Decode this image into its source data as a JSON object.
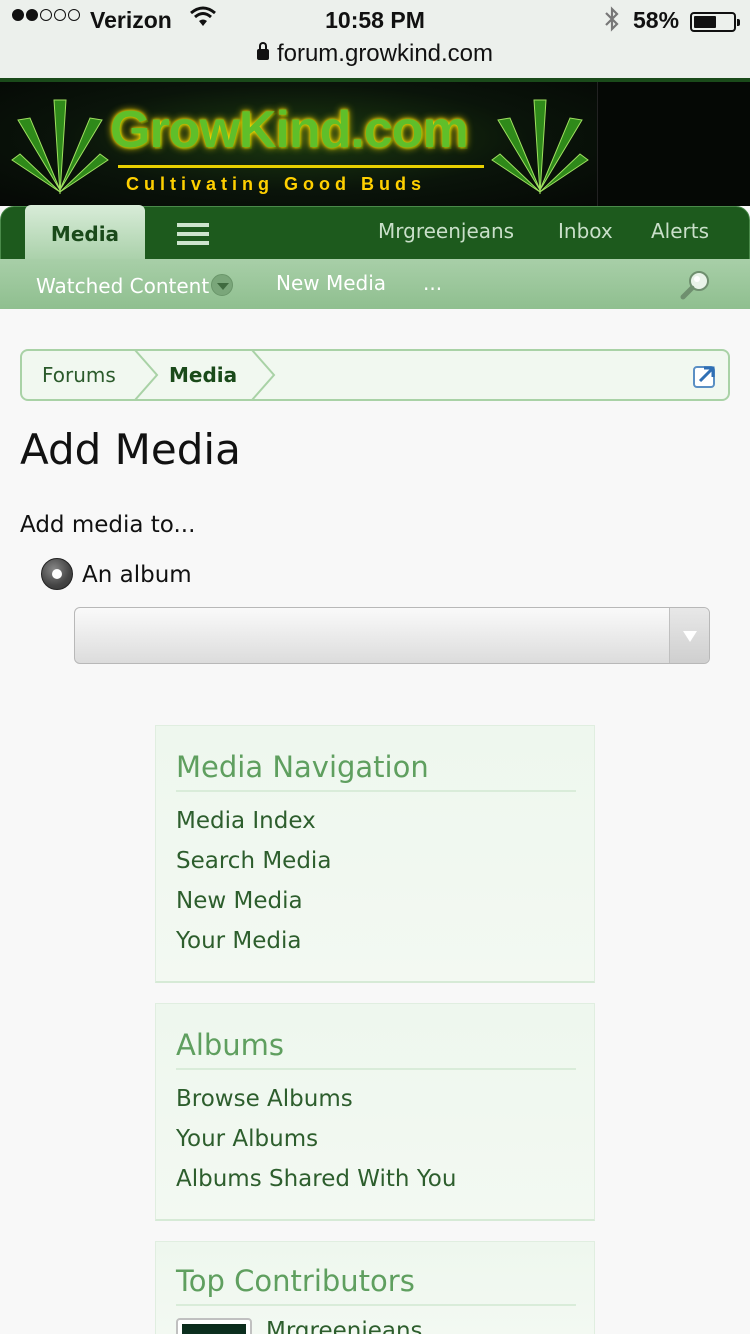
{
  "status_bar": {
    "carrier": "Verizon",
    "time": "10:58 PM",
    "battery": "58%",
    "battery_level": 0.58,
    "url": "forum.growkind.com"
  },
  "banner": {
    "logo_text": "GrowKind.com",
    "tagline": "Cultivating Good Buds"
  },
  "nav": {
    "active_tab": "Media",
    "user": "Mrgreenjeans",
    "inbox": "Inbox",
    "alerts": "Alerts"
  },
  "subnav": {
    "watched": "Watched Content",
    "new_media": "New Media",
    "more": "..."
  },
  "breadcrumb": {
    "items": [
      "Forums",
      "Media"
    ]
  },
  "page": {
    "title": "Add Media",
    "add_to_label": "Add media to...",
    "radio_album": "An album",
    "album_select_value": ""
  },
  "panels": {
    "media_navigation": {
      "title": "Media Navigation",
      "links": [
        "Media Index",
        "Search Media",
        "New Media",
        "Your Media"
      ]
    },
    "albums": {
      "title": "Albums",
      "links": [
        "Browse Albums",
        "Your Albums",
        "Albums Shared With You"
      ]
    },
    "top_contributors": {
      "title": "Top Contributors",
      "first_user": "Mrgreenjeans"
    }
  },
  "colors": {
    "nav_dark": "#1d5a1d",
    "subnav": "#9cc79c",
    "panel_title": "#5f9f5f",
    "link": "#2d5e2d"
  }
}
